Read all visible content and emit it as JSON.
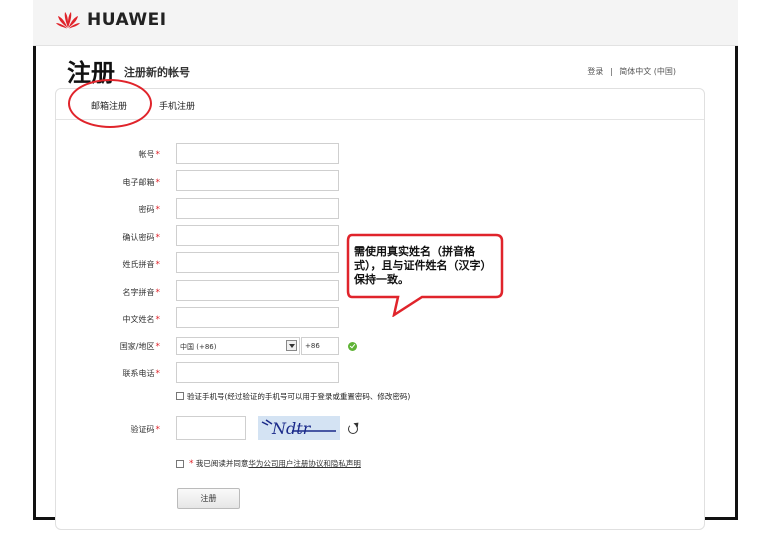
{
  "header": {
    "brand": "HUAWEI"
  },
  "page": {
    "title": "注册",
    "subtitle": "注册新的帐号",
    "login_link": "登录",
    "separator": "|",
    "language_link": "简体中文 (中国)"
  },
  "tabs": [
    {
      "label": "邮箱注册"
    },
    {
      "label": "手机注册"
    }
  ],
  "form": {
    "fields": [
      {
        "label": "帐号"
      },
      {
        "label": "电子邮箱"
      },
      {
        "label": "密码"
      },
      {
        "label": "确认密码"
      },
      {
        "label": "姓氏拼音"
      },
      {
        "label": "名字拼音"
      },
      {
        "label": "中文姓名"
      },
      {
        "label": "国家/地区"
      },
      {
        "label": "联系电话"
      }
    ],
    "required_mark": "*",
    "country_value": "中国 (+86)",
    "phone_code": "+86",
    "verify_phone_label": "验证手机号(经过验证的手机号可以用于登录或重置密码、修改密码)",
    "captcha_label": "验证码",
    "captcha_text": "Ndtr",
    "agree_prefix": "我已阅读并同意",
    "agree_link": "华为公司用户注册协议和隐私声明",
    "submit_label": "注册"
  },
  "callout": {
    "text": "需使用真实姓名（拼音格式），且与证件姓名（汉字）保持一致。",
    "border_color": "#e0242b"
  },
  "colors": {
    "accent_red": "#e0242b",
    "ok_green": "#5fb336"
  }
}
